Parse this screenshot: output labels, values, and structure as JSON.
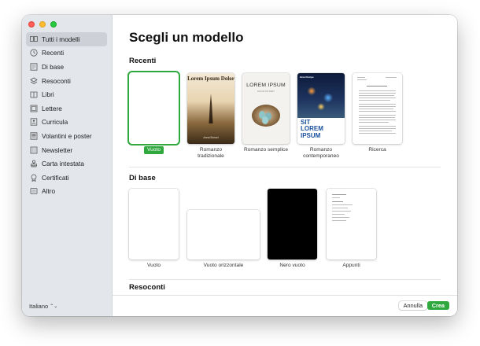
{
  "sidebar": {
    "items": [
      {
        "label": "Tutti i modelli",
        "icon": "templates-grid-icon"
      },
      {
        "label": "Recenti",
        "icon": "clock-icon"
      },
      {
        "label": "Di base",
        "icon": "document-icon"
      },
      {
        "label": "Resoconti",
        "icon": "report-icon"
      },
      {
        "label": "Libri",
        "icon": "book-icon"
      },
      {
        "label": "Lettere",
        "icon": "letter-icon"
      },
      {
        "label": "Curricula",
        "icon": "resume-icon"
      },
      {
        "label": "Volantini e poster",
        "icon": "poster-icon"
      },
      {
        "label": "Newsletter",
        "icon": "newsletter-icon"
      },
      {
        "label": "Carta intestata",
        "icon": "stamp-icon"
      },
      {
        "label": "Certificati",
        "icon": "certificate-icon"
      },
      {
        "label": "Altro",
        "icon": "other-icon"
      }
    ],
    "language": "Italiano",
    "language_icon": "⌃"
  },
  "main": {
    "title": "Scegli un modello",
    "sections": {
      "recenti": {
        "title": "Recenti",
        "items": [
          {
            "caption": "Vuoto",
            "selected": true
          },
          {
            "caption": "Romanzo tradizionale",
            "cover_title": "Lorem Ipsum Dolor",
            "cover_author": "Anna Bonuri"
          },
          {
            "caption": "Romanzo semplice",
            "cover_title": "LOREM IPSUM",
            "cover_subtitle": "DOLOR SIT AMET"
          },
          {
            "caption": "Romanzo contemporaneo",
            "cover_author": "Gina Rompe",
            "cover_title": "SIT LOREM IPSUM"
          },
          {
            "caption": "Ricerca"
          }
        ]
      },
      "di_base": {
        "title": "Di base",
        "items": [
          {
            "caption": "Vuoto"
          },
          {
            "caption": "Vuoto orizzontale"
          },
          {
            "caption": "Nero vuoto"
          },
          {
            "caption": "Appunti"
          }
        ]
      },
      "resoconti": {
        "title": "Resoconti"
      }
    }
  },
  "footer": {
    "cancel_label": "Annulla",
    "create_label": "Crea"
  },
  "colors": {
    "accent_green": "#2fa83d",
    "sidebar_bg": "#e3e6eb"
  }
}
